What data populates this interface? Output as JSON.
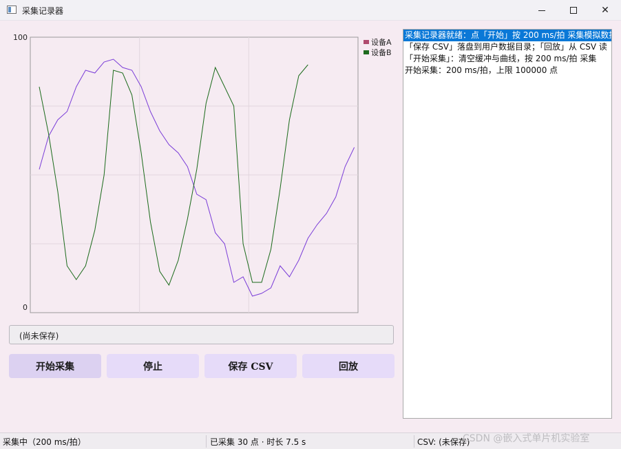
{
  "window": {
    "title": "采集记录器",
    "icon": "app-window-icon"
  },
  "chart_data": {
    "type": "line",
    "title": "",
    "xlabel": "",
    "ylabel": "",
    "ylim": [
      0,
      100
    ],
    "ytick_labels": [
      "100",
      "0"
    ],
    "grid": true,
    "legend_position": "right",
    "x": [
      1,
      2,
      3,
      4,
      5,
      6,
      7,
      8,
      9,
      10,
      11,
      12,
      13,
      14,
      15,
      16,
      17,
      18,
      19,
      20,
      21,
      22,
      23,
      24,
      25,
      26,
      27,
      28,
      29,
      30,
      31,
      32,
      33,
      34,
      35
    ],
    "series": [
      {
        "name": "设备A",
        "color": "#7a3dd8",
        "legend_color": "#b04a6e",
        "values": [
          52,
          64,
          70,
          73,
          82,
          88,
          87,
          91,
          92,
          89,
          88,
          82,
          73,
          66,
          61,
          58,
          53,
          43,
          41,
          29,
          25,
          11,
          13,
          6,
          7,
          9,
          17,
          13,
          19,
          27,
          32,
          36,
          42,
          53,
          60
        ]
      },
      {
        "name": "设备B",
        "color": "#1a6a1a",
        "legend_color": "#1e6a1e",
        "values": [
          82,
          65,
          44,
          17,
          12,
          17,
          30,
          50,
          88,
          87,
          79,
          58,
          33,
          15,
          10,
          19,
          34,
          52,
          76,
          89,
          82,
          75,
          25,
          11,
          11,
          23,
          45,
          70,
          86,
          90
        ]
      }
    ]
  },
  "status_field": {
    "text": "(尚未保存)"
  },
  "buttons": {
    "start": "开始采集",
    "stop": "停止",
    "save": "保存 CSV",
    "replay": "回放"
  },
  "log": {
    "lines": [
      "采集记录器就绪：点「开始」按 200 ms/拍 采集模拟数据",
      "「保存 CSV」落盘到用户数据目录；「回放」从 CSV 读",
      "「开始采集」：清空缓冲与曲线，按 200 ms/拍 采集",
      "开始采集：200 ms/拍，上限 100000 点"
    ],
    "selected_index": 0
  },
  "statusbar": {
    "state": "采集中（200 ms/拍）",
    "count": "已采集 30 点 · 时长 7.5 s",
    "csv": "CSV: (未保存)"
  },
  "watermark": "CSDN @嵌入式单片机实验室"
}
